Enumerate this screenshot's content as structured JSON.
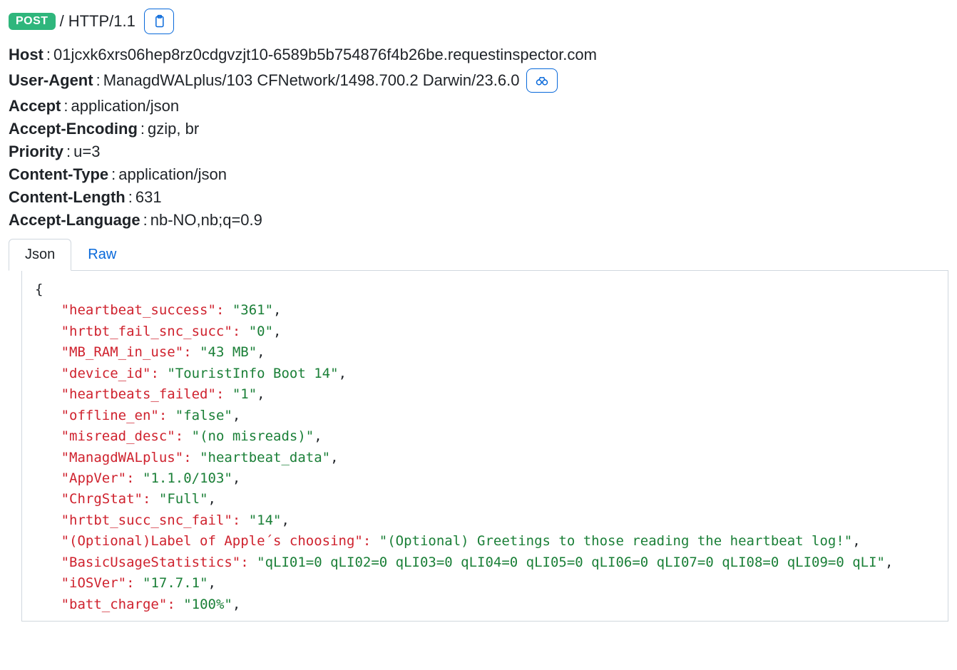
{
  "request": {
    "method": "POST",
    "path": "/",
    "protocol": "HTTP/1.1"
  },
  "headers": [
    {
      "name": "Host",
      "value": "01jcxk6xrs06hep8rz0cdgvzjt10-6589b5b754876f4b26be.requestinspector.com"
    },
    {
      "name": "User-Agent",
      "value": "ManagdWALplus/103 CFNetwork/1498.700.2 Darwin/23.6.0",
      "analyze": true
    },
    {
      "name": "Accept",
      "value": "application/json"
    },
    {
      "name": "Accept-Encoding",
      "value": "gzip, br"
    },
    {
      "name": "Priority",
      "value": "u=3"
    },
    {
      "name": "Content-Type",
      "value": "application/json"
    },
    {
      "name": "Content-Length",
      "value": "631"
    },
    {
      "name": "Accept-Language",
      "value": "nb-NO,nb;q=0.9"
    }
  ],
  "tabs": {
    "json": "Json",
    "raw": "Raw",
    "active": "json"
  },
  "body_json": [
    {
      "k": "heartbeat_success",
      "v": "361"
    },
    {
      "k": "hrtbt_fail_snc_succ",
      "v": "0"
    },
    {
      "k": "MB_RAM_in_use",
      "v": "43 MB"
    },
    {
      "k": "device_id",
      "v": "TouristInfo Boot 14"
    },
    {
      "k": "heartbeats_failed",
      "v": "1"
    },
    {
      "k": "offline_en",
      "v": "false"
    },
    {
      "k": "misread_desc",
      "v": "(no misreads)"
    },
    {
      "k": "ManagdWALplus",
      "v": "heartbeat_data"
    },
    {
      "k": "AppVer",
      "v": "1.1.0/103"
    },
    {
      "k": "ChrgStat",
      "v": "Full"
    },
    {
      "k": "hrtbt_succ_snc_fail",
      "v": "14"
    },
    {
      "k": "(Optional)Label of Apple´s choosing",
      "v": "(Optional) Greetings to those reading the heartbeat log!"
    },
    {
      "k": "BasicUsageStatistics",
      "v": "qLI01=0 qLI02=0 qLI03=0 qLI04=0 qLI05=0 qLI06=0 qLI07=0 qLI08=0 qLI09=0 qLI"
    },
    {
      "k": "iOSVer",
      "v": "17.7.1"
    },
    {
      "k": "batt_charge",
      "v": "100%"
    }
  ],
  "icons": {
    "copy": "clipboard-icon",
    "analyze": "binoculars-icon"
  }
}
